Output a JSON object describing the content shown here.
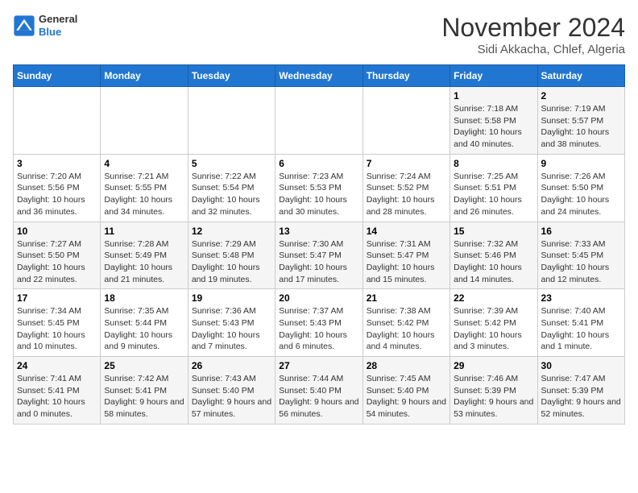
{
  "header": {
    "logo_line1": "General",
    "logo_line2": "Blue",
    "month": "November 2024",
    "location": "Sidi Akkacha, Chlef, Algeria"
  },
  "weekdays": [
    "Sunday",
    "Monday",
    "Tuesday",
    "Wednesday",
    "Thursday",
    "Friday",
    "Saturday"
  ],
  "weeks": [
    [
      {
        "day": "",
        "info": ""
      },
      {
        "day": "",
        "info": ""
      },
      {
        "day": "",
        "info": ""
      },
      {
        "day": "",
        "info": ""
      },
      {
        "day": "",
        "info": ""
      },
      {
        "day": "1",
        "info": "Sunrise: 7:18 AM\nSunset: 5:58 PM\nDaylight: 10 hours and 40 minutes."
      },
      {
        "day": "2",
        "info": "Sunrise: 7:19 AM\nSunset: 5:57 PM\nDaylight: 10 hours and 38 minutes."
      }
    ],
    [
      {
        "day": "3",
        "info": "Sunrise: 7:20 AM\nSunset: 5:56 PM\nDaylight: 10 hours and 36 minutes."
      },
      {
        "day": "4",
        "info": "Sunrise: 7:21 AM\nSunset: 5:55 PM\nDaylight: 10 hours and 34 minutes."
      },
      {
        "day": "5",
        "info": "Sunrise: 7:22 AM\nSunset: 5:54 PM\nDaylight: 10 hours and 32 minutes."
      },
      {
        "day": "6",
        "info": "Sunrise: 7:23 AM\nSunset: 5:53 PM\nDaylight: 10 hours and 30 minutes."
      },
      {
        "day": "7",
        "info": "Sunrise: 7:24 AM\nSunset: 5:52 PM\nDaylight: 10 hours and 28 minutes."
      },
      {
        "day": "8",
        "info": "Sunrise: 7:25 AM\nSunset: 5:51 PM\nDaylight: 10 hours and 26 minutes."
      },
      {
        "day": "9",
        "info": "Sunrise: 7:26 AM\nSunset: 5:50 PM\nDaylight: 10 hours and 24 minutes."
      }
    ],
    [
      {
        "day": "10",
        "info": "Sunrise: 7:27 AM\nSunset: 5:50 PM\nDaylight: 10 hours and 22 minutes."
      },
      {
        "day": "11",
        "info": "Sunrise: 7:28 AM\nSunset: 5:49 PM\nDaylight: 10 hours and 21 minutes."
      },
      {
        "day": "12",
        "info": "Sunrise: 7:29 AM\nSunset: 5:48 PM\nDaylight: 10 hours and 19 minutes."
      },
      {
        "day": "13",
        "info": "Sunrise: 7:30 AM\nSunset: 5:47 PM\nDaylight: 10 hours and 17 minutes."
      },
      {
        "day": "14",
        "info": "Sunrise: 7:31 AM\nSunset: 5:47 PM\nDaylight: 10 hours and 15 minutes."
      },
      {
        "day": "15",
        "info": "Sunrise: 7:32 AM\nSunset: 5:46 PM\nDaylight: 10 hours and 14 minutes."
      },
      {
        "day": "16",
        "info": "Sunrise: 7:33 AM\nSunset: 5:45 PM\nDaylight: 10 hours and 12 minutes."
      }
    ],
    [
      {
        "day": "17",
        "info": "Sunrise: 7:34 AM\nSunset: 5:45 PM\nDaylight: 10 hours and 10 minutes."
      },
      {
        "day": "18",
        "info": "Sunrise: 7:35 AM\nSunset: 5:44 PM\nDaylight: 10 hours and 9 minutes."
      },
      {
        "day": "19",
        "info": "Sunrise: 7:36 AM\nSunset: 5:43 PM\nDaylight: 10 hours and 7 minutes."
      },
      {
        "day": "20",
        "info": "Sunrise: 7:37 AM\nSunset: 5:43 PM\nDaylight: 10 hours and 6 minutes."
      },
      {
        "day": "21",
        "info": "Sunrise: 7:38 AM\nSunset: 5:42 PM\nDaylight: 10 hours and 4 minutes."
      },
      {
        "day": "22",
        "info": "Sunrise: 7:39 AM\nSunset: 5:42 PM\nDaylight: 10 hours and 3 minutes."
      },
      {
        "day": "23",
        "info": "Sunrise: 7:40 AM\nSunset: 5:41 PM\nDaylight: 10 hours and 1 minute."
      }
    ],
    [
      {
        "day": "24",
        "info": "Sunrise: 7:41 AM\nSunset: 5:41 PM\nDaylight: 10 hours and 0 minutes."
      },
      {
        "day": "25",
        "info": "Sunrise: 7:42 AM\nSunset: 5:41 PM\nDaylight: 9 hours and 58 minutes."
      },
      {
        "day": "26",
        "info": "Sunrise: 7:43 AM\nSunset: 5:40 PM\nDaylight: 9 hours and 57 minutes."
      },
      {
        "day": "27",
        "info": "Sunrise: 7:44 AM\nSunset: 5:40 PM\nDaylight: 9 hours and 56 minutes."
      },
      {
        "day": "28",
        "info": "Sunrise: 7:45 AM\nSunset: 5:40 PM\nDaylight: 9 hours and 54 minutes."
      },
      {
        "day": "29",
        "info": "Sunrise: 7:46 AM\nSunset: 5:39 PM\nDaylight: 9 hours and 53 minutes."
      },
      {
        "day": "30",
        "info": "Sunrise: 7:47 AM\nSunset: 5:39 PM\nDaylight: 9 hours and 52 minutes."
      }
    ]
  ]
}
